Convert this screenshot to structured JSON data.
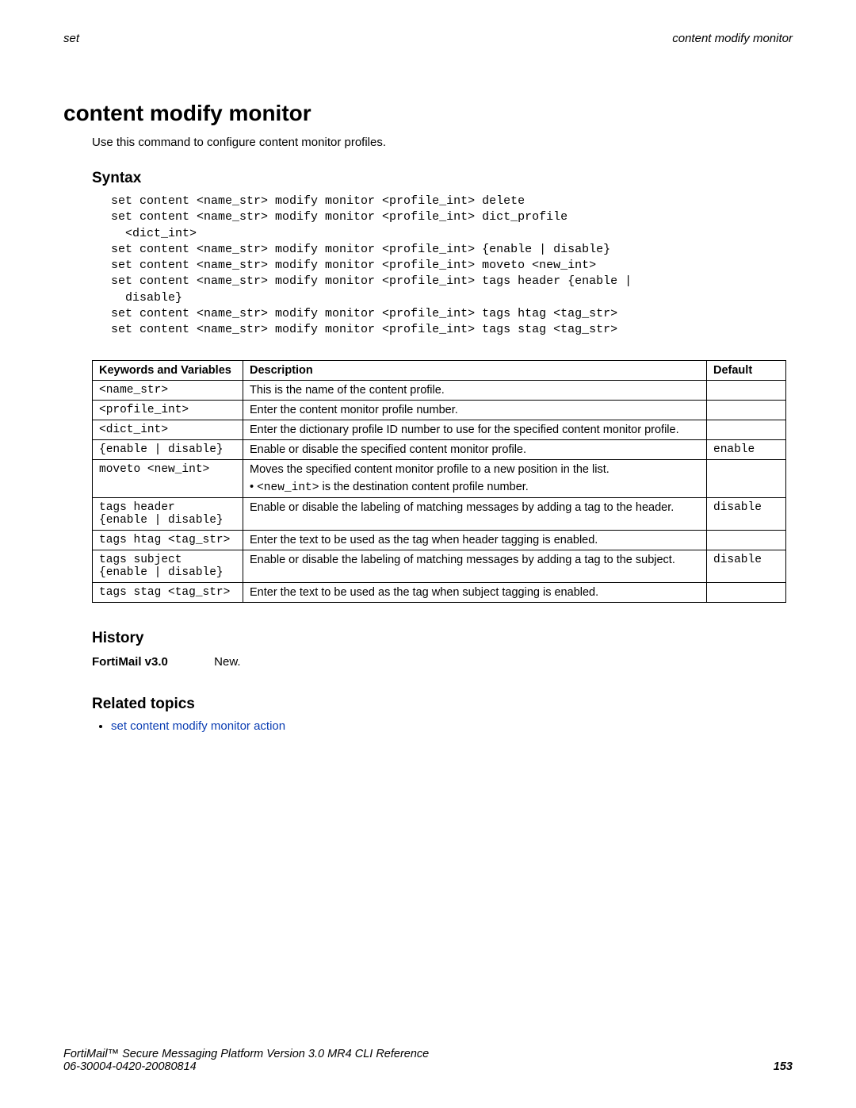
{
  "header": {
    "left": "set",
    "right": "content modify monitor"
  },
  "title": "content modify monitor",
  "intro": "Use this command to configure content monitor profiles.",
  "syntax": {
    "heading": "Syntax",
    "text": "set content <name_str> modify monitor <profile_int> delete\nset content <name_str> modify monitor <profile_int> dict_profile\n  <dict_int>\nset content <name_str> modify monitor <profile_int> {enable | disable}\nset content <name_str> modify monitor <profile_int> moveto <new_int>\nset content <name_str> modify monitor <profile_int> tags header {enable |\n  disable}\nset content <name_str> modify monitor <profile_int> tags htag <tag_str>\nset content <name_str> modify monitor <profile_int> tags stag <tag_str>"
  },
  "table": {
    "headers": {
      "kw": "Keywords and Variables",
      "desc": "Description",
      "def": "Default"
    },
    "rows": [
      {
        "kw": "<name_str>",
        "desc": "This is the name of the content profile.",
        "def": ""
      },
      {
        "kw": "<profile_int>",
        "desc": "Enter the content monitor profile number.",
        "def": ""
      },
      {
        "kw": "<dict_int>",
        "desc": "Enter the dictionary profile ID number to use for the specified content monitor profile.",
        "def": ""
      },
      {
        "kw": "{enable | disable}",
        "desc": "Enable or disable the specified content monitor profile.",
        "def": "enable"
      },
      {
        "kw": "moveto <new_int>",
        "desc": "Moves the specified content monitor profile to a new position in the list.",
        "desc2_prefix": "• ",
        "desc2_code": "<new_int>",
        "desc2_suffix": " is the destination content profile number.",
        "def": ""
      },
      {
        "kw": "tags header\n{enable | disable}",
        "desc": "Enable or disable the labeling of matching messages by adding a tag to the header.",
        "def": "disable"
      },
      {
        "kw": "tags htag <tag_str>",
        "desc": "Enter the text to be used as the tag when header tagging is enabled.",
        "def": ""
      },
      {
        "kw": "tags subject\n{enable | disable}",
        "desc": "Enable or disable the labeling of matching messages by adding a tag to the subject.",
        "def": "disable"
      },
      {
        "kw": "tags stag <tag_str>",
        "desc": "Enter the text to be used as the tag when subject tagging is enabled.",
        "def": ""
      }
    ]
  },
  "history": {
    "heading": "History",
    "label": "FortiMail v3.0",
    "value": "New."
  },
  "related": {
    "heading": "Related topics",
    "links": [
      "set content modify monitor action"
    ]
  },
  "footer": {
    "line1": "FortiMail™ Secure Messaging Platform Version 3.0 MR4 CLI Reference",
    "line2": "06-30004-0420-20080814",
    "page": "153"
  }
}
